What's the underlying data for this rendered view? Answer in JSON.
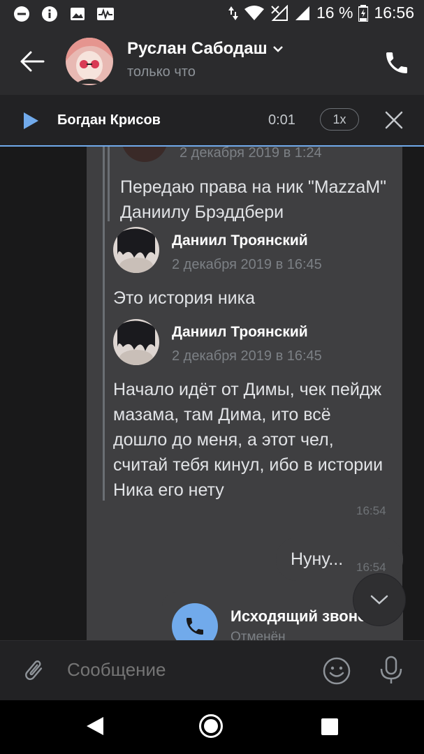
{
  "status_bar": {
    "battery": "16 %",
    "time": "16:56"
  },
  "header": {
    "name": "Руслан Сабодаш",
    "status": "только что"
  },
  "audio_player": {
    "track": "Богдан Крисов",
    "position": "0:01",
    "speed": "1x"
  },
  "forwarded": {
    "date_top": "2 декабря 2019 в 1:24",
    "first_text": "Передаю права на ник \"MazzaM\" Даниилу Брэддбери",
    "items": [
      {
        "author": "Даниил Троянский",
        "date": "2 декабря 2019 в 16:45",
        "text": "Это история ника"
      },
      {
        "author": "Даниил Троянский",
        "date": "2 декабря 2019 в 16:45",
        "text": "Начало идёт от Димы, чек пейдж мазама, там Дима, ито всё дошло до меня, а этот чел, считай тебя кинул, ибо в истории Ника его нету"
      }
    ],
    "time": "16:54"
  },
  "outgoing": {
    "text": "Нуну...",
    "time": "16:54"
  },
  "call_message": {
    "title": "Исходящий звонок",
    "status": "Отменён"
  },
  "composer": {
    "placeholder": "Сообщение"
  },
  "colors": {
    "accent": "#71aaeb",
    "background": "#19191a",
    "bubble": "#3f3f41",
    "bar": "#2b2b2d"
  }
}
